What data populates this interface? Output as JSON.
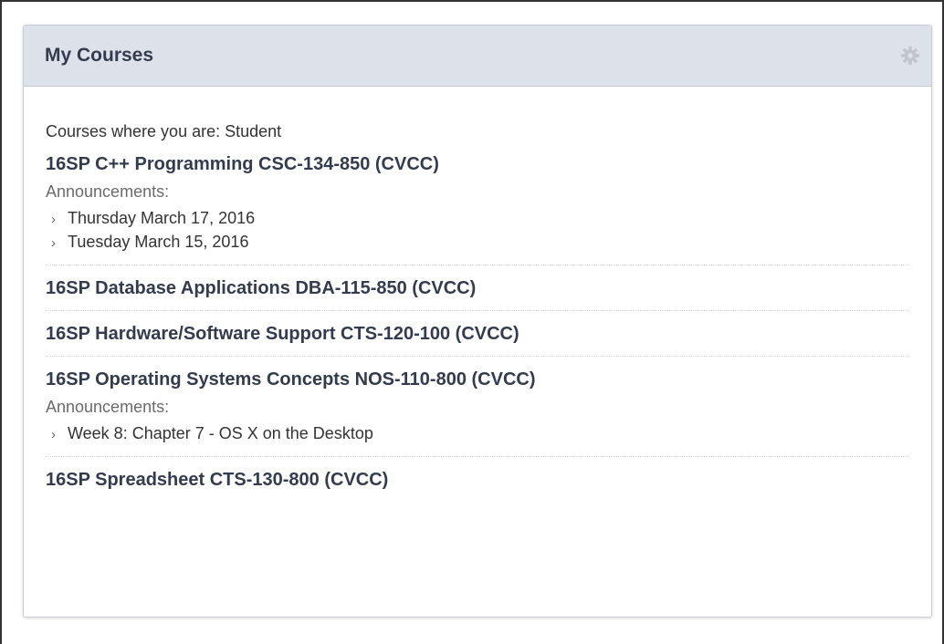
{
  "module": {
    "title": "My Courses",
    "settings_icon": "gear-icon"
  },
  "role_line": "Courses where you are: Student",
  "courses": [
    {
      "name": "16SP C++ Programming CSC-134-850 (CVCC)",
      "announcements_label": "Announcements:",
      "announcements": [
        "Thursday March 17, 2016",
        "Tuesday March 15, 2016"
      ]
    },
    {
      "name": "16SP Database Applications DBA-115-850 (CVCC)"
    },
    {
      "name": "16SP Hardware/Software Support CTS-120-100 (CVCC)"
    },
    {
      "name": "16SP Operating Systems Concepts NOS-110-800 (CVCC)",
      "announcements_label": "Announcements:",
      "announcements": [
        "Week 8: Chapter 7 - OS X on the Desktop"
      ]
    },
    {
      "name": "16SP Spreadsheet CTS-130-800 (CVCC)"
    }
  ],
  "colors": {
    "header_bg": "#dde2ea",
    "title_text": "#333c4e"
  }
}
